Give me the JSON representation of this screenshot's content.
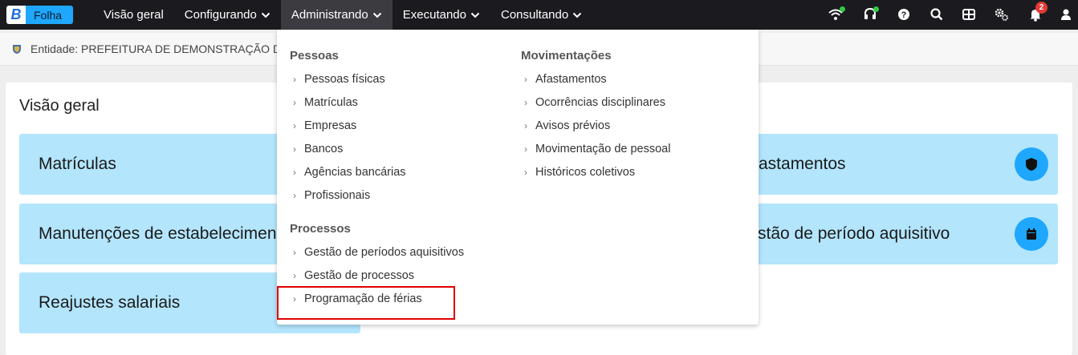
{
  "app": {
    "logo_letter": "B",
    "name": "Folha"
  },
  "nav": {
    "items": [
      {
        "label": "Visão geral",
        "dropdown": false
      },
      {
        "label": "Configurando",
        "dropdown": true
      },
      {
        "label": "Administrando",
        "dropdown": true,
        "active": true
      },
      {
        "label": "Executando",
        "dropdown": true
      },
      {
        "label": "Consultando",
        "dropdown": true
      }
    ]
  },
  "toolbar": {
    "icons": [
      "wifi-icon",
      "headset-icon",
      "help-icon",
      "search-icon",
      "apps-icon",
      "settings-icon",
      "bell-icon",
      "user-icon"
    ],
    "notification_count": "2"
  },
  "entity": {
    "label": "Entidade: PREFEITURA DE DEMONSTRAÇÃO DE"
  },
  "overview": {
    "title": "Visão geral",
    "tiles": {
      "matriculas": "Matrículas",
      "manutencoes": "Manutenções de estabelecimen",
      "reajustes": "Reajustes salariais",
      "afastamentos": "astamentos",
      "gestao_periodo": "stão de período aquisitivo"
    }
  },
  "dropdown": {
    "pessoas": {
      "heading": "Pessoas",
      "items": [
        "Pessoas físicas",
        "Matrículas",
        "Empresas",
        "Bancos",
        "Agências bancárias",
        "Profissionais"
      ]
    },
    "processos": {
      "heading": "Processos",
      "items": [
        "Gestão de períodos aquisitivos",
        "Gestão de processos",
        "Programação de férias"
      ]
    },
    "movimentacoes": {
      "heading": "Movimentações",
      "items": [
        "Afastamentos",
        "Ocorrências disciplinares",
        "Avisos prévios",
        "Movimentação de pessoal",
        "Históricos coletivos"
      ]
    }
  },
  "colors": {
    "topbar": "#1b1b1f",
    "accent": "#1ea7fd",
    "tile": "#b3e5fc",
    "highlight": "#e00000"
  }
}
